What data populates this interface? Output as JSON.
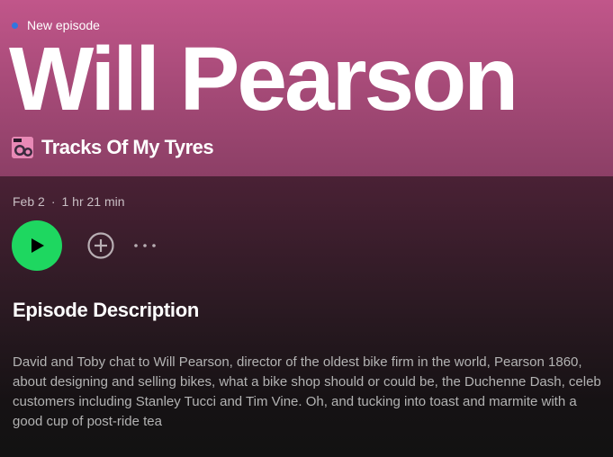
{
  "episode": {
    "badge": "New episode",
    "badge_color": "#2f76e0",
    "title": "Will Pearson",
    "show_name": "Tracks Of My Tyres",
    "date": "Feb 2",
    "separator": "·",
    "duration": "1 hr 21 min"
  },
  "controls": {
    "play_icon": "play-icon",
    "add_icon": "plus-circle-icon",
    "more_icon": "more-options-icon",
    "accent_color": "#1ed760"
  },
  "description": {
    "heading": "Episode Description",
    "text": "David and Toby chat to Will Pearson, director of the oldest bike firm in the world, Pearson 1860, about designing and selling bikes, what a bike shop should or could be, the Duchenne Dash, celeb customers including Stanley Tucci and Tim Vine. Oh, and tucking into toast and marmite with a good cup of post-ride tea"
  },
  "theme": {
    "header_color": "#c1568a",
    "background": "#121212"
  }
}
